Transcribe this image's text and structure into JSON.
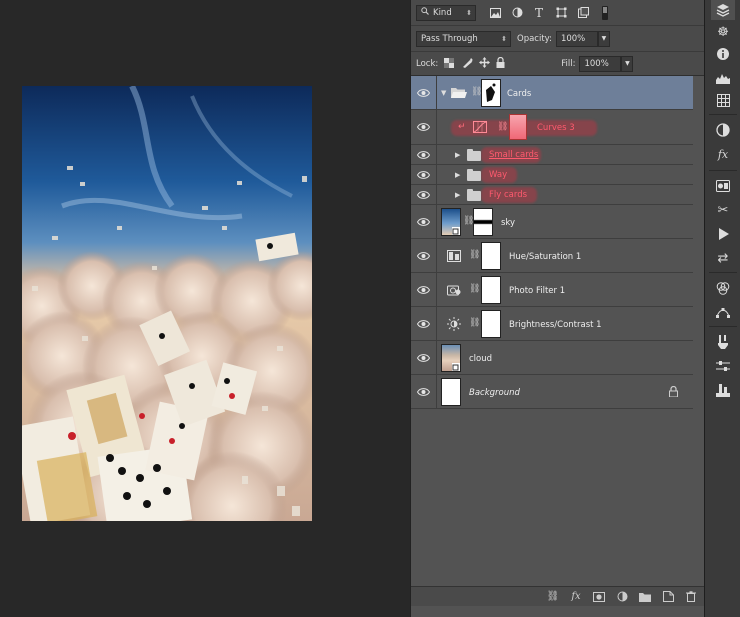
{
  "filter_bar": {
    "kind_label": "Kind",
    "icons": [
      "pixel-filter-icon",
      "adjustment-filter-icon",
      "type-filter-icon",
      "shape-filter-icon",
      "smart-object-filter-icon",
      "filter-toggle-icon"
    ]
  },
  "blend_bar": {
    "blend_mode": "Pass Through",
    "opacity_label": "Opacity:",
    "opacity_value": "100%"
  },
  "lock_bar": {
    "lock_label": "Lock:",
    "fill_label": "Fill:",
    "fill_value": "100%"
  },
  "layers": [
    {
      "name": "Cards",
      "type": "group-open",
      "selected": true
    },
    {
      "name": "Curves 3",
      "type": "adjustment-clipped",
      "highlight": true
    },
    {
      "name": "Small cards",
      "type": "group",
      "highlight": true
    },
    {
      "name": "Way",
      "type": "group",
      "highlight": true
    },
    {
      "name": "Fly cards",
      "type": "group",
      "highlight": true
    },
    {
      "name": "sky",
      "type": "smart-object-masked"
    },
    {
      "name": "Hue/Saturation 1",
      "type": "adjustment"
    },
    {
      "name": "Photo Filter 1",
      "type": "adjustment"
    },
    {
      "name": "Brightness/Contrast 1",
      "type": "adjustment"
    },
    {
      "name": "cloud",
      "type": "smart-object"
    },
    {
      "name": "Background",
      "type": "background",
      "locked": true
    }
  ],
  "colors": {
    "panel_bg": "#535353",
    "selected_layer": "#6e7f99",
    "highlight_red": "#ff5a6e",
    "canvas_bg": "#282828"
  }
}
